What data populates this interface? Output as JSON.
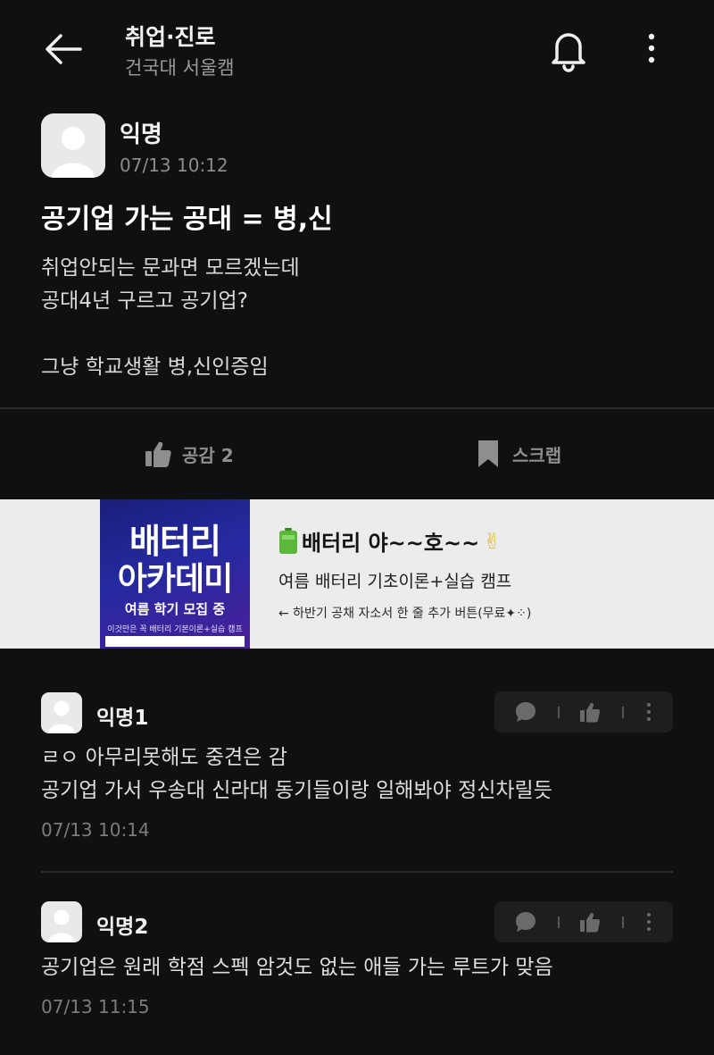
{
  "header": {
    "board_title": "취업·진로",
    "board_subtitle": "건국대 서울캠",
    "icons": [
      "back-arrow-icon",
      "bell-icon",
      "more-vertical-icon"
    ]
  },
  "post": {
    "author": "익명",
    "time": "07/13 10:12",
    "title": "공기업 가는 공대 = 병,신",
    "body_lines": [
      "취업안되는 문과면 모르겠는데",
      "공대4년 구르고 공기업?",
      "",
      "그냥 학교생활 병,신인증임"
    ]
  },
  "actions": {
    "like_label": "공감 2",
    "scrap_label": "스크랩"
  },
  "ad": {
    "image_line1": "배터리",
    "image_line2": "아카데미",
    "image_line3": "여름 학기 모집 중",
    "image_line4": "이것만은 꼭 배터리 기본이론+실습 캠프",
    "headline": "배터리 야~~호~~",
    "headline_emoji": "✌",
    "subline": "여름 배터리 기초이론+실습 캠프",
    "note": "← 하반기 공채 자소서 한 줄 추가 버튼(무료✦⁘)"
  },
  "comments": [
    {
      "author": "익명1",
      "lines": [
        "ㄹㅇ 아무리못해도 중견은 감",
        "공기업 가서 우송대 신라대 동기들이랑 일해봐야 정신차릴듯"
      ],
      "time": "07/13 10:14"
    },
    {
      "author": "익명2",
      "lines": [
        "공기업은 원래 학점 스펙 암것도 없는 애들 가는 루트가 맞음"
      ],
      "time": "07/13 11:15"
    }
  ],
  "colors": {
    "background": "#101010",
    "text": "#ececec",
    "muted": "#8c8c8c",
    "ad_background": "#ececec",
    "ad_image": "#252aa0"
  }
}
